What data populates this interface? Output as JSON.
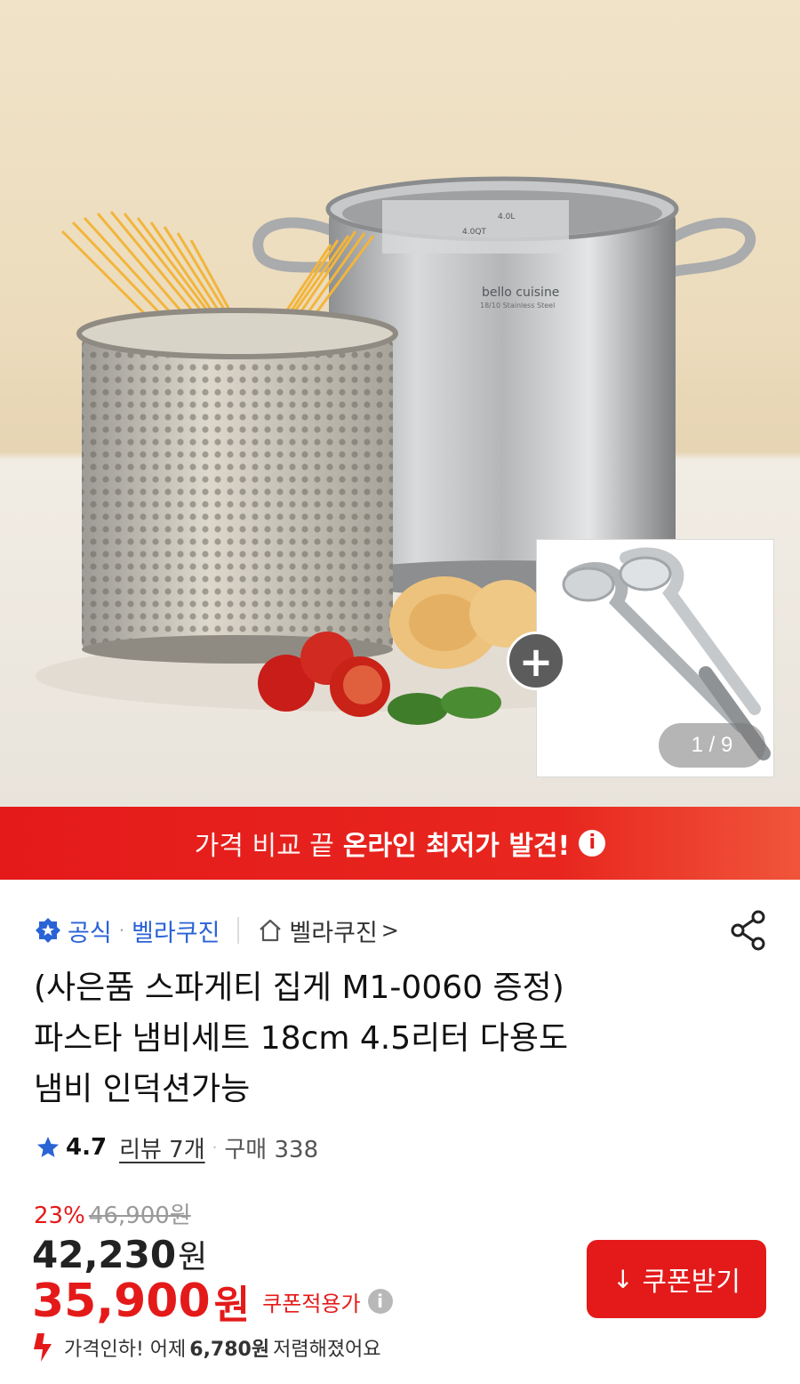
{
  "image": {
    "counter": "1 / 9",
    "plus_symbol": "+",
    "pot_brand": "bello cuisine",
    "pot_subtitle": "18/10 Stainless Steel",
    "mark_4l": "4.0L",
    "mark_4qt": "4.0QT"
  },
  "banner": {
    "plain": "가격 비교 끝",
    "bold": "온라인 최저가 발견!",
    "info_icon": "i"
  },
  "seller": {
    "official": "공식",
    "brand": "벨라쿠진",
    "store": "벨라쿠진",
    "store_arrow": ">"
  },
  "product": {
    "title_line1": "(사은품 스파게티 집게 M1-0060 증정)",
    "title_line2": "파스타 냄비세트 18cm 4.5리터 다용도",
    "title_line3": "냄비 인덕션가능"
  },
  "rating": {
    "score": "4.7",
    "reviews": "리뷰 7개",
    "purchases": "구매 338"
  },
  "price": {
    "discount_rate": "23%",
    "original": "46,900원",
    "current": "42,230",
    "current_unit": "원",
    "coupon_price": "35,900",
    "coupon_unit": "원",
    "coupon_label": "쿠폰적용가",
    "coupon_info_icon": "i",
    "drop_prefix": "가격인하! 어제",
    "drop_amount": "6,780원",
    "drop_suffix": "저렴해졌어요"
  },
  "coupon_button": {
    "arrow": "↓",
    "label": "쿠폰받기"
  },
  "colors": {
    "accent_red": "#e41a1a",
    "link_blue": "#2a63d6"
  },
  "icons": [
    "official-badge-icon",
    "home-icon",
    "share-icon",
    "star-icon",
    "price-drop-icon",
    "info-icon",
    "download-arrow-icon",
    "plus-icon"
  ]
}
